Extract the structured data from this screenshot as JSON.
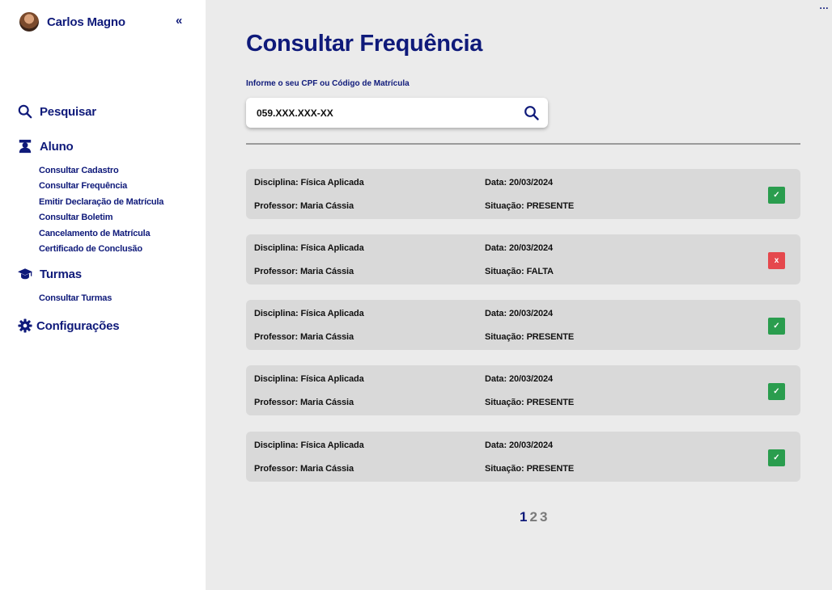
{
  "user": {
    "name": "Carlos Magno"
  },
  "collapse_icon": "«",
  "more_icon": "...",
  "nav": {
    "search": {
      "label": "Pesquisar",
      "icon": "search-icon"
    },
    "student": {
      "label": "Aluno",
      "icon": "student-icon",
      "items": [
        "Consultar Cadastro",
        "Consultar Frequência",
        "Emitir Declaração de Matrícula",
        "Consultar Boletim",
        "Cancelamento de Matrícula",
        "Certificado de Conclusão"
      ]
    },
    "classes": {
      "label": "Turmas",
      "icon": "graduation-cap-icon",
      "items": [
        "Consultar Turmas"
      ]
    },
    "settings": {
      "label": "Configurações",
      "icon": "gear-icon"
    }
  },
  "main": {
    "title": "Consultar Frequência",
    "search_label": "Informe o seu CPF ou Código de Matrícula",
    "search_value": "059.XXX.XXX-XX"
  },
  "records": [
    {
      "discipline": "Disciplina: Física Aplicada",
      "professor": "Professor: Maria Cássia",
      "date": "Data: 20/03/2024",
      "situation": "Situação: PRESENTE",
      "status": "present",
      "mark": "✓"
    },
    {
      "discipline": "Disciplina: Física Aplicada",
      "professor": "Professor: Maria Cássia",
      "date": "Data: 20/03/2024",
      "situation": "Situação: FALTA",
      "status": "absent",
      "mark": "x"
    },
    {
      "discipline": "Disciplina: Física Aplicada",
      "professor": "Professor: Maria Cássia",
      "date": "Data: 20/03/2024",
      "situation": "Situação: PRESENTE",
      "status": "present",
      "mark": "✓"
    },
    {
      "discipline": "Disciplina: Física Aplicada",
      "professor": "Professor: Maria Cássia",
      "date": "Data: 20/03/2024",
      "situation": "Situação: PRESENTE",
      "status": "present",
      "mark": "✓"
    },
    {
      "discipline": "Disciplina: Física Aplicada",
      "professor": "Professor: Maria Cássia",
      "date": "Data: 20/03/2024",
      "situation": "Situação: PRESENTE",
      "status": "present",
      "mark": "✓"
    }
  ],
  "pagination": {
    "pages": [
      "1",
      "2",
      "3"
    ],
    "current": "1"
  },
  "colors": {
    "primary": "#0f1a7a",
    "present": "#2a9d4e",
    "absent": "#e5484d",
    "inactive_page": "#7a7a7a"
  }
}
